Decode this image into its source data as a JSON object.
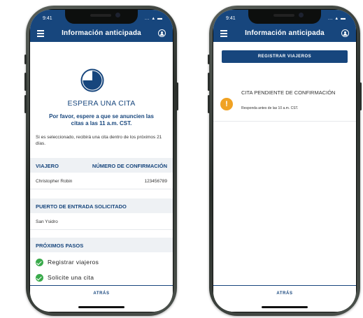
{
  "left_phone": {
    "time": "9:41",
    "status_icons": "… ▴ ▬",
    "header": {
      "title": "Información anticipada",
      "menu_icon": "menu-icon",
      "user_icon": "user-icon"
    },
    "status_icon": "pie-clock-icon",
    "wait_title": "ESPERA UNA CITA",
    "wait_subtitle": "Por favor, espere a que se anuncien las citas a las 11 a.m. CST.",
    "wait_note": "Si es seleccionado, recibirá una cita dentro de los próximos 21 días.",
    "traveler_table": {
      "col_traveler": "VIAJERO",
      "col_confirmation": "NÚMERO DE CONFIRMACIÓN",
      "traveler_name": "Christopher Robin",
      "confirmation_number": "123456789"
    },
    "port_section": {
      "header": "PUERTO DE ENTRADA SOLICITADO",
      "value": "San Ysidro"
    },
    "next_steps": {
      "header": "PRÓXIMOS PASOS",
      "items": [
        "Registrar viajeros",
        "Solicite una cita"
      ]
    },
    "back_label": "ATRÁS"
  },
  "right_phone": {
    "time": "9:41",
    "status_icons": "… ▴ ▬",
    "header": {
      "title": "Información anticipada",
      "menu_icon": "menu-icon",
      "user_icon": "user-icon"
    },
    "register_button": "REGISTRAR VIAJEROS",
    "pending": {
      "icon": "warning-icon",
      "icon_glyph": "!",
      "title": "CITA PENDIENTE DE CONFIRMACIÓN",
      "subtitle": "Responda antes de las 10 a.m. CST."
    },
    "back_label": "ATRÁS"
  },
  "colors": {
    "brand_blue": "#17467d",
    "success_green": "#3aaa4b",
    "warning_orange": "#f0a223",
    "section_bg": "#eef1f4"
  }
}
